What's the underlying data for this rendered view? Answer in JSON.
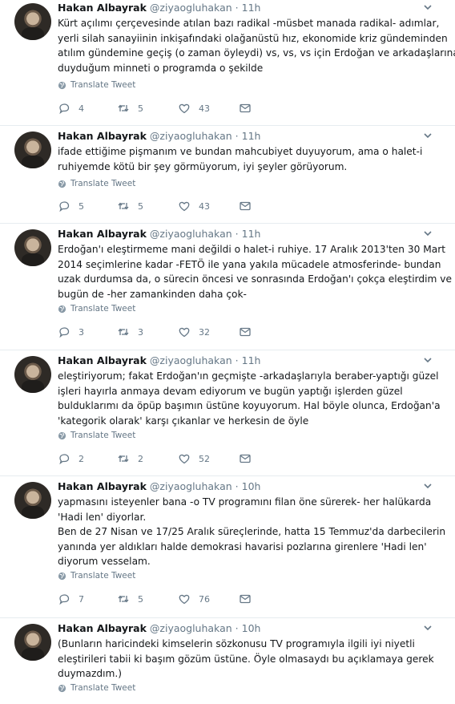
{
  "colors": {
    "text": "#14171a",
    "muted": "#657786",
    "divider": "#e6ecf0"
  },
  "translate_label": "Translate Tweet",
  "tweets": [
    {
      "name": "Hakan Albayrak",
      "handle": "@ziyaogluhakan",
      "dot": "·",
      "time": "11h",
      "lines": [
        "Kürt açılımı çerçevesinde atılan bazı radikal -müsbet manada radikal- adımlar,",
        "yerli silah sanayiinin inkişafındaki olağanüstü hız, ekonomide kriz gündeminden",
        "atılım gündemine geçiş (o zaman öyleydi) vs, vs, vs için Erdoğan ve arkadaşlarına",
        "duyduğum minneti o programda o şekilde"
      ],
      "replies": "4",
      "retweets": "5",
      "likes": "43"
    },
    {
      "name": "Hakan Albayrak",
      "handle": "@ziyaogluhakan",
      "dot": "·",
      "time": "11h",
      "lines": [
        "ifade ettiğime pişmanım ve bundan mahcubiyet duyuyorum, ama o halet-i",
        "ruhiyemde kötü bir şey görmüyorum, iyi şeyler görüyorum."
      ],
      "replies": "5",
      "retweets": "5",
      "likes": "43"
    },
    {
      "name": "Hakan Albayrak",
      "handle": "@ziyaogluhakan",
      "dot": "·",
      "time": "11h",
      "lines": [
        "Erdoğan'ı eleştirmeme mani değildi o halet-i ruhiye. 17 Aralık  2013'ten 30 Mart",
        "2014 seçimlerine kadar -FETÖ ile yana yakıla mücadele atmosferinde- bundan",
        "uzak durdumsa da, o sürecin öncesi ve sonrasında Erdoğan'ı çokça eleştirdim ve",
        "bugün de -her zamankinden daha çok-"
      ],
      "replies": "3",
      "retweets": "3",
      "likes": "32"
    },
    {
      "name": "Hakan Albayrak",
      "handle": "@ziyaogluhakan",
      "dot": "·",
      "time": "11h",
      "lines": [
        "eleştiriyorum; fakat Erdoğan'ın geçmişte -arkadaşlarıyla beraber-yaptığı güzel",
        "işleri hayırla anmaya devam ediyorum ve bugün yaptığı işlerden güzel",
        "bulduklarımı da öpüp başımın üstüne koyuyorum. Hal böyle olunca, Erdoğan'a",
        "'kategorik olarak' karşı çıkanlar ve herkesin de öyle"
      ],
      "replies": "2",
      "retweets": "2",
      "likes": "52"
    },
    {
      "name": "Hakan Albayrak",
      "handle": "@ziyaogluhakan",
      "dot": "·",
      "time": "10h",
      "lines": [
        "yapmasını isteyenler bana -o TV programını filan öne sürerek- her halükarda",
        "'Hadi len' diyorlar.",
        "Ben de 27 Nisan ve 17/25 Aralık süreçlerinde, hatta 15 Temmuz'da darbecilerin",
        "yanında yer aldıkları halde demokrasi havarisi pozlarına girenlere 'Hadi len'",
        "diyorum vesselam."
      ],
      "replies": "7",
      "retweets": "5",
      "likes": "76"
    },
    {
      "name": "Hakan Albayrak",
      "handle": "@ziyaogluhakan",
      "dot": "·",
      "time": "10h",
      "lines": [
        "(Bunların haricindeki kimselerin sözkonusu TV programıyla ilgili iyi niyetli",
        "eleştirileri tabii ki başım gözüm üstüne. Öyle olmasaydı bu açıklamaya gerek",
        "duymazdım.)"
      ],
      "replies": null,
      "retweets": null,
      "likes": null
    }
  ]
}
